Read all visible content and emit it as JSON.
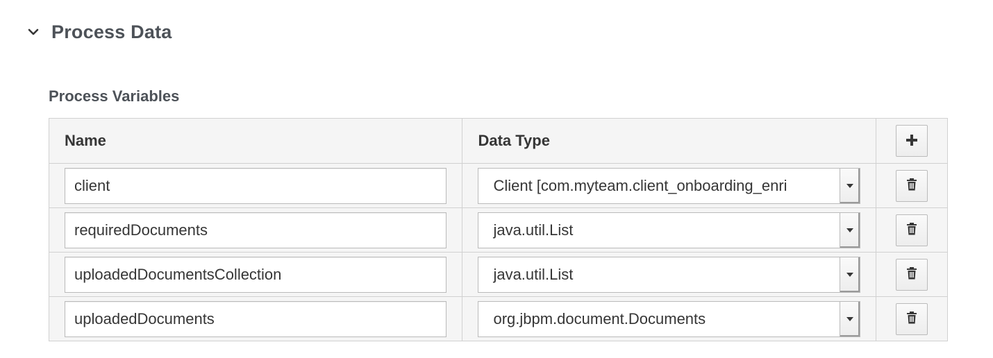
{
  "section": {
    "title": "Process Data",
    "expanded_icon": "chevron-down-icon"
  },
  "process_variables": {
    "title": "Process Variables",
    "columns": {
      "name": "Name",
      "data_type": "Data Type"
    },
    "add_icon": "plus-icon",
    "delete_icon": "trash-icon",
    "rows": [
      {
        "name": "client",
        "data_type": "Client [com.myteam.client_onboarding_enri"
      },
      {
        "name": "requiredDocuments",
        "data_type": "java.util.List"
      },
      {
        "name": "uploadedDocumentsCollection",
        "data_type": "java.util.List"
      },
      {
        "name": "uploadedDocuments",
        "data_type": "org.jbpm.document.Documents"
      }
    ]
  },
  "colors": {
    "heading": "#4d5258",
    "table_bg": "#f5f5f5",
    "border": "#d1d1d1"
  }
}
